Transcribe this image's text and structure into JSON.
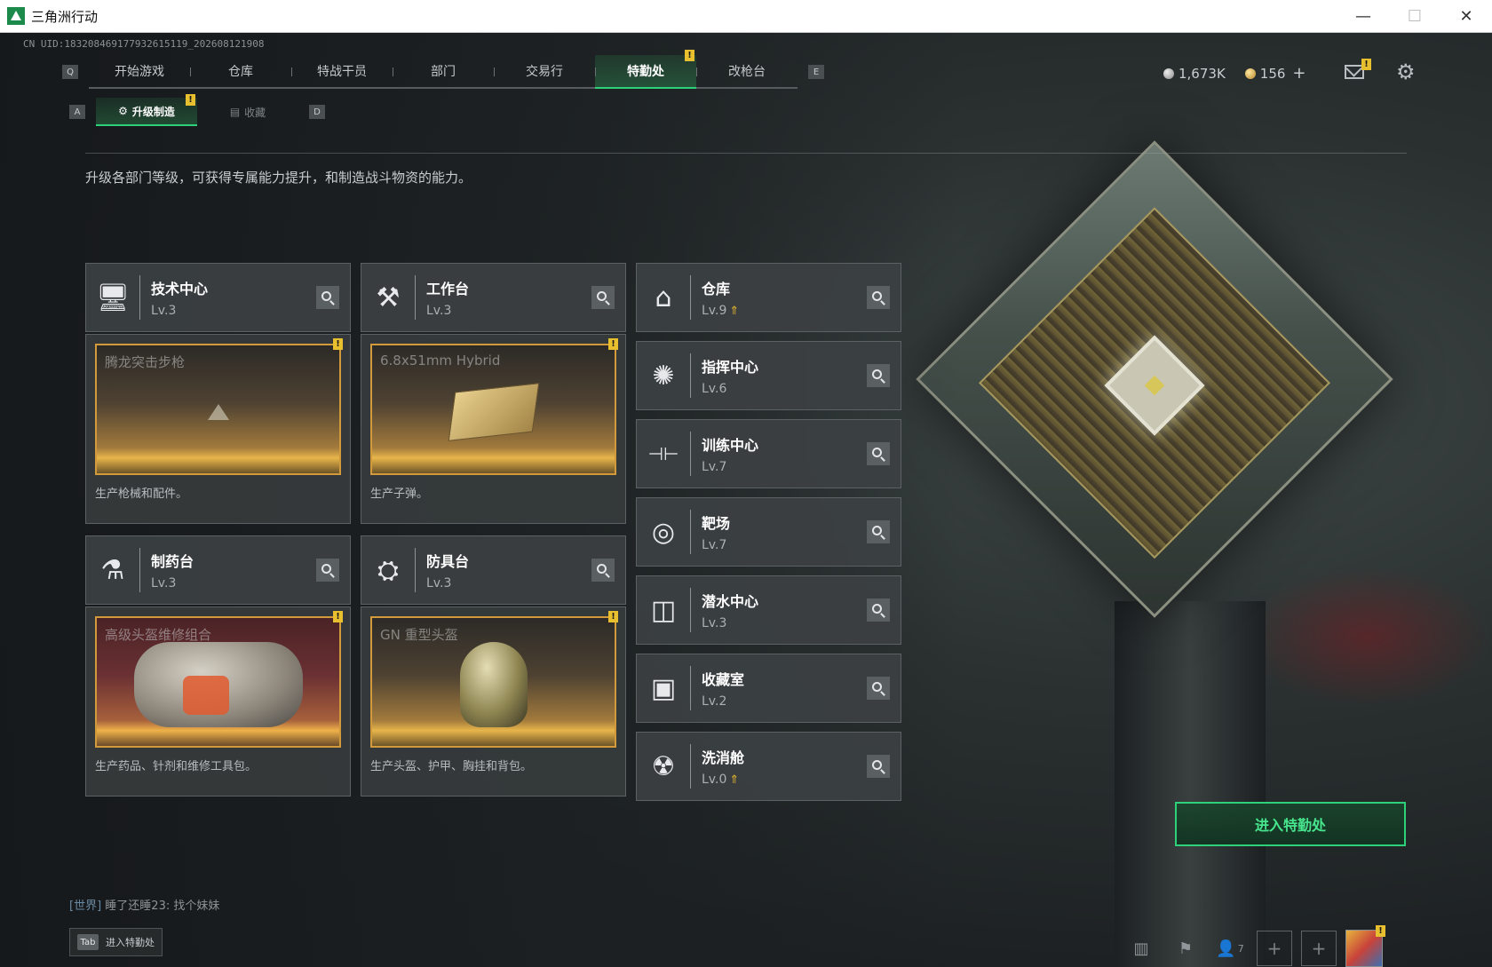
{
  "window": {
    "title": "三角洲行动",
    "minimize": "—",
    "maximize": "☐",
    "close": "✕"
  },
  "uid": "CN UID:183208469177932615119_202608121908",
  "nav": {
    "prev_key": "Q",
    "next_key": "E",
    "tabs": [
      {
        "label": "开始游戏",
        "active": false
      },
      {
        "label": "仓库",
        "active": false
      },
      {
        "label": "特战干员",
        "active": false
      },
      {
        "label": "部门",
        "active": false
      },
      {
        "label": "交易行",
        "active": false
      },
      {
        "label": "特勤处",
        "active": true,
        "badge": "!"
      },
      {
        "label": "改枪台",
        "active": false
      }
    ]
  },
  "currency": {
    "silver": "1,673K",
    "gold": "156",
    "add": "+"
  },
  "mail_badge": "!",
  "subnav": {
    "prev_key": "A",
    "next_key": "D",
    "tabs": [
      {
        "label": "升级制造",
        "active": true,
        "badge": "!",
        "icon": "gear-cog-icon"
      },
      {
        "label": "收藏",
        "active": false,
        "icon": "collection-icon"
      }
    ]
  },
  "description": "升级各部门等级，可获得专属能力提升，和制造战斗物资的能力。",
  "production_departments": [
    {
      "name": "技术中心",
      "level": "Lv.3",
      "icon": "tech-center-icon",
      "product": "腾龙突击步枪",
      "product_desc": "生产枪械和配件。",
      "badge": "!",
      "tone": "gold"
    },
    {
      "name": "工作台",
      "level": "Lv.3",
      "icon": "workbench-icon",
      "product": "6.8x51mm Hybrid",
      "product_desc": "生产子弹。",
      "badge": "!",
      "tone": "gold"
    },
    {
      "name": "制药台",
      "level": "Lv.3",
      "icon": "pharmacy-icon",
      "product": "高级头盔维修组合",
      "product_desc": "生产药品、针剂和维修工具包。",
      "badge": "!",
      "tone": "red"
    },
    {
      "name": "防具台",
      "level": "Lv.3",
      "icon": "armor-bench-icon",
      "product": "GN 重型头盔",
      "product_desc": "生产头盔、护甲、胸挂和背包。",
      "badge": "!",
      "tone": "gold"
    }
  ],
  "other_departments": [
    {
      "name": "仓库",
      "level": "Lv.9",
      "upgradable": true,
      "icon": "warehouse-icon"
    },
    {
      "name": "指挥中心",
      "level": "Lv.6",
      "upgradable": false,
      "icon": "command-center-icon"
    },
    {
      "name": "训练中心",
      "level": "Lv.7",
      "upgradable": false,
      "icon": "training-center-icon"
    },
    {
      "name": "靶场",
      "level": "Lv.7",
      "upgradable": false,
      "icon": "shooting-range-icon"
    },
    {
      "name": "潜水中心",
      "level": "Lv.3",
      "upgradable": false,
      "icon": "diving-center-icon"
    },
    {
      "name": "收藏室",
      "level": "Lv.2",
      "upgradable": false,
      "icon": "collection-room-icon"
    },
    {
      "name": "洗消舱",
      "level": "Lv.0",
      "upgradable": true,
      "icon": "decontamination-icon"
    }
  ],
  "enter_button": "进入特勤处",
  "chat": {
    "channel": "[世界]",
    "message": "睡了还睡23: 找个妹妹"
  },
  "tab_hint": {
    "key": "Tab",
    "label": "进入特勤处"
  },
  "bottom_bar": {
    "friend_count": "7",
    "avatar_badge": "!",
    "add_slot": "+"
  }
}
